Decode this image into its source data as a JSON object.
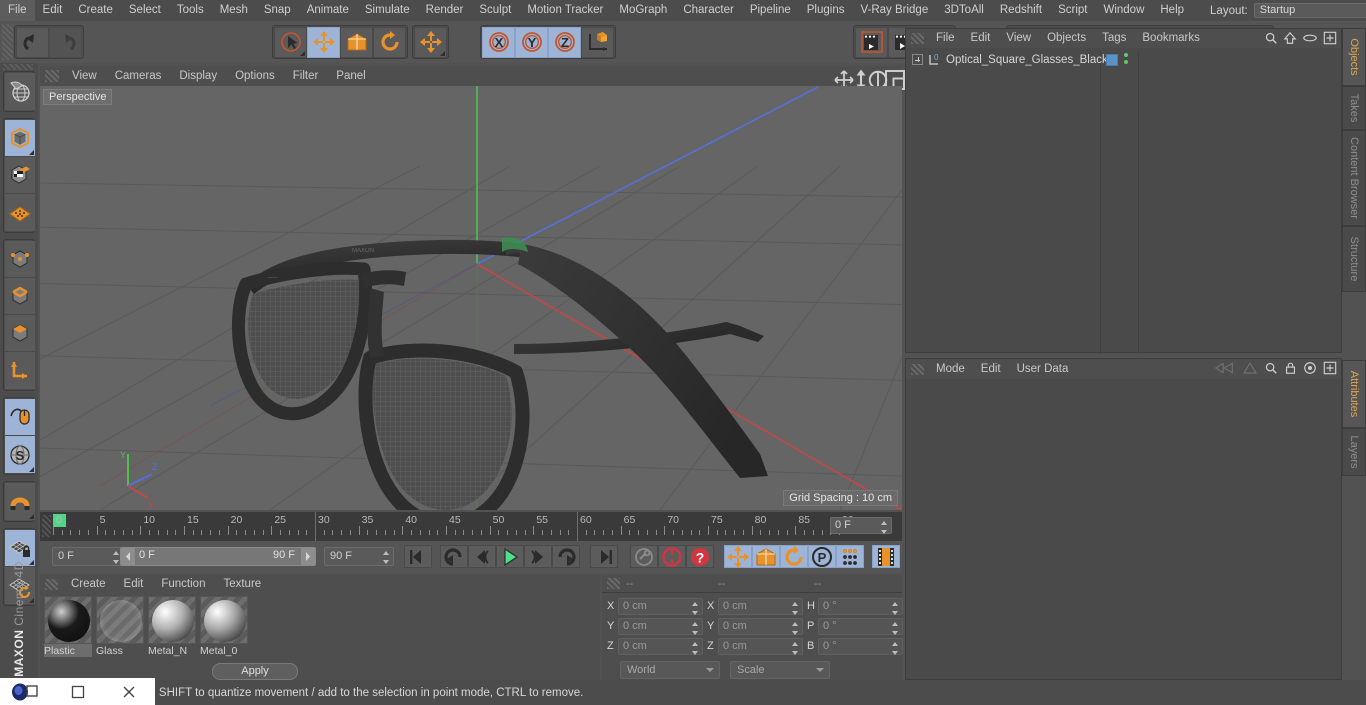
{
  "app": {
    "name": "Cinema 4D",
    "brand": "MAXON"
  },
  "menubar": {
    "items": [
      "File",
      "Edit",
      "Create",
      "Select",
      "Tools",
      "Mesh",
      "Snap",
      "Animate",
      "Simulate",
      "Render",
      "Sculpt",
      "Motion Tracker",
      "MoGraph",
      "Character",
      "Pipeline",
      "Plugins",
      "V-Ray Bridge",
      "3DToAll",
      "Redshift",
      "Script",
      "Window",
      "Help"
    ],
    "layout_label": "Layout:",
    "layout_value": "Startup",
    "search_icon": "search-icon"
  },
  "toolbar": {
    "groups": [
      {
        "name": "undo-redo",
        "buttons": [
          {
            "name": "undo",
            "icon": "undo-arrow-icon",
            "active": false,
            "dim": false
          },
          {
            "name": "redo",
            "icon": "redo-arrow-icon",
            "active": false,
            "dim": true
          }
        ]
      },
      {
        "name": "transform-tools",
        "buttons": [
          {
            "name": "live-selection",
            "icon": "cursor-circle-icon",
            "active": false,
            "dim": false,
            "corner": true
          },
          {
            "name": "move",
            "icon": "move-arrows-icon",
            "active": true,
            "dim": false
          },
          {
            "name": "scale",
            "icon": "scale-box-icon",
            "active": false,
            "dim": false
          },
          {
            "name": "rotate",
            "icon": "rotate-arc-icon",
            "active": false,
            "dim": false
          }
        ]
      },
      {
        "name": "free-move",
        "buttons": [
          {
            "name": "free-move",
            "icon": "move-arrows-icon",
            "active": false,
            "dim": false,
            "corner": true
          }
        ]
      },
      {
        "name": "axis-locks",
        "buttons": [
          {
            "name": "lock-x",
            "icon": "axis-x-icon",
            "active": true,
            "dim": false
          },
          {
            "name": "lock-y",
            "icon": "axis-y-icon",
            "active": true,
            "dim": false
          },
          {
            "name": "lock-z",
            "icon": "axis-z-icon",
            "active": true,
            "dim": false
          },
          {
            "name": "world-object-coord",
            "icon": "world-axis-cube-icon",
            "active": false,
            "dim": false
          }
        ]
      },
      {
        "name": "render-tools",
        "buttons": [
          {
            "name": "render-view",
            "icon": "clapper-view-icon",
            "active": false,
            "dim": false
          },
          {
            "name": "render-region",
            "icon": "clapper-region-icon",
            "active": false,
            "dim": false,
            "corner": true
          },
          {
            "name": "render-settings",
            "icon": "clapper-gear-icon",
            "active": false,
            "dim": false,
            "corner": true
          }
        ]
      },
      {
        "name": "create-objects",
        "buttons": [
          {
            "name": "add-cube",
            "icon": "blue-cube-icon",
            "active": false,
            "dim": false,
            "corner": true
          },
          {
            "name": "add-spline",
            "icon": "pen-spline-icon",
            "active": false,
            "dim": false,
            "corner": true
          },
          {
            "name": "add-generator",
            "icon": "green-cube-nurbs-icon",
            "active": false,
            "dim": false,
            "corner": true
          },
          {
            "name": "add-array",
            "icon": "green-cluster-icon",
            "active": false,
            "dim": false,
            "corner": true
          },
          {
            "name": "add-deformer",
            "icon": "purple-bend-icon",
            "active": false,
            "dim": false,
            "corner": true
          },
          {
            "name": "add-scene-floor",
            "icon": "grid-floor-icon",
            "active": false,
            "dim": false,
            "corner": true
          },
          {
            "name": "add-camera",
            "icon": "camera-icon",
            "active": false,
            "dim": false,
            "corner": true
          },
          {
            "name": "add-light",
            "icon": "lightbulb-icon",
            "active": false,
            "dim": false,
            "corner": true
          }
        ]
      }
    ]
  },
  "left_toolbar": {
    "buttons": [
      {
        "name": "make-editable",
        "icon": "globe-wire-icon",
        "active": false
      },
      {
        "name": "model-mode",
        "icon": "grey-cube-orange-outline-icon",
        "active": true,
        "corner": true
      },
      {
        "name": "texture-mode",
        "icon": "checker-cube-icon",
        "active": false
      },
      {
        "name": "point-mode-grid",
        "icon": "orange-grid-diamond-icon",
        "active": false
      },
      {
        "name": "points-mode",
        "icon": "cube-points-icon",
        "active": false
      },
      {
        "name": "edges-mode",
        "icon": "cube-edges-icon",
        "active": false
      },
      {
        "name": "polygons-mode",
        "icon": "cube-polygons-icon",
        "active": false
      },
      {
        "name": "axis-mode",
        "icon": "orange-axis-L-icon",
        "active": false
      },
      {
        "name": "enable-snapping",
        "icon": "mouse-snap-icon",
        "active": true
      },
      {
        "name": "workplane-mode",
        "icon": "s-sphere-icon",
        "active": true,
        "corner": true
      },
      {
        "name": "magnet-tool",
        "icon": "magnet-icon",
        "active": false,
        "corner": true
      },
      {
        "name": "lock-workplane",
        "icon": "grid-lock-icon",
        "active": true,
        "corner": true
      },
      {
        "name": "rotate-workplane",
        "icon": "grid-rotate-icon",
        "active": false,
        "corner": true
      }
    ]
  },
  "viewport": {
    "menu": [
      "View",
      "Cameras",
      "Display",
      "Options",
      "Filter",
      "Panel"
    ],
    "label": "Perspective",
    "grid_spacing": "Grid Spacing : 10 cm",
    "axis_gizmo": {
      "x": "X",
      "y": "Y",
      "z": "Z",
      "x_color": "#d04a4a",
      "y_color": "#4fbf4f",
      "z_color": "#5570d8"
    },
    "right_icons": [
      "pan-icon",
      "dolly-icon",
      "rotate-view-icon",
      "maximize-view-icon"
    ],
    "model_name": "optical-square-glasses-black"
  },
  "timeline": {
    "ticks": [
      0,
      5,
      10,
      15,
      20,
      25,
      30,
      35,
      40,
      45,
      50,
      55,
      60,
      65,
      70,
      75,
      80,
      85,
      90
    ],
    "current_frame_field": "0 F",
    "playhead_frame": 0
  },
  "playback": {
    "current_frame": "0 F",
    "range_start": "0 F",
    "range_end": "90 F",
    "max_frame": "90 F",
    "buttons": [
      {
        "name": "go-to-start",
        "icon": "skip-start-icon",
        "active": false
      },
      {
        "name": "previous-keyframe",
        "icon": "prev-key-icon",
        "active": false
      },
      {
        "name": "step-back",
        "icon": "step-back-icon",
        "active": false
      },
      {
        "name": "play",
        "icon": "play-icon",
        "active": false
      },
      {
        "name": "step-forward",
        "icon": "step-forward-icon",
        "active": false
      },
      {
        "name": "next-keyframe",
        "icon": "next-key-icon",
        "active": false
      },
      {
        "name": "go-to-end",
        "icon": "skip-end-icon",
        "active": false
      },
      {
        "name": "record-active-objects",
        "icon": "key-grey-icon",
        "active": false
      },
      {
        "name": "autokeying",
        "icon": "record-red-icon",
        "active": false
      },
      {
        "name": "keyframe-help",
        "icon": "question-red-icon",
        "active": false
      },
      {
        "name": "key-position",
        "icon": "move-arrows-icon",
        "active": true
      },
      {
        "name": "key-scale",
        "icon": "scale-box-icon",
        "active": true
      },
      {
        "name": "key-rotation",
        "icon": "rotate-arc-icon",
        "active": true
      },
      {
        "name": "key-parameter",
        "icon": "p-circle-icon",
        "active": true
      },
      {
        "name": "key-point-level",
        "icon": "dots-grid-icon",
        "active": true
      },
      {
        "name": "timeline-toggle",
        "icon": "film-strip-icon",
        "active": true
      }
    ]
  },
  "material_manager": {
    "menu": [
      "Create",
      "Edit",
      "Function",
      "Texture"
    ],
    "materials": [
      {
        "name": "Plastic",
        "color": "#1a1a1a",
        "highlight": "#cfcfcf",
        "selected": true,
        "type": "solid"
      },
      {
        "name": "Glass",
        "color": "transparent",
        "highlight": "none",
        "selected": false,
        "type": "transparent"
      },
      {
        "name": "Metal_N",
        "color": "#b0b0b0",
        "highlight": "#ffffff",
        "selected": false,
        "type": "solid"
      },
      {
        "name": "Metal_0",
        "color": "#a8a8a8",
        "highlight": "#ffffff",
        "selected": false,
        "type": "solid"
      }
    ]
  },
  "coordinates": {
    "header_cols": [
      "--",
      "--",
      "--"
    ],
    "position": {
      "label_x": "X",
      "label_y": "Y",
      "label_z": "Z",
      "x": "0 cm",
      "y": "0 cm",
      "z": "0 cm"
    },
    "size": {
      "label_x": "X",
      "label_y": "Y",
      "label_z": "Z",
      "x": "0 cm",
      "y": "0 cm",
      "z": "0 cm"
    },
    "rotation": {
      "label_h": "H",
      "label_p": "P",
      "label_b": "B",
      "h": "0 °",
      "p": "0 °",
      "b": "0 °"
    },
    "space_dropdown": "World",
    "mode_dropdown": "Scale",
    "apply_button": "Apply"
  },
  "object_manager": {
    "menu": [
      "File",
      "Edit",
      "View",
      "Objects",
      "Tags",
      "Bookmarks"
    ],
    "right_icons": [
      "search-icon",
      "home-icon",
      "ellipse-icon",
      "plus-box-icon"
    ],
    "objects": [
      {
        "name": "Optical_Square_Glasses_Black",
        "layer": "0",
        "tag_color": "#5b93c9",
        "visible_dots": 2
      }
    ]
  },
  "attribute_manager": {
    "menu": [
      "Mode",
      "Edit",
      "User Data"
    ],
    "right_icons": [
      "nav-back-icon",
      "nav-up-icon",
      "search-icon",
      "lock-icon",
      "target-icon",
      "plus-box-icon"
    ]
  },
  "right_tabs": {
    "top": [
      {
        "label": "Objects",
        "active": true
      },
      {
        "label": "Takes",
        "active": false
      },
      {
        "label": "Content Browser",
        "active": false
      },
      {
        "label": "Structure",
        "active": false
      }
    ],
    "bottom": [
      {
        "label": "Attributes",
        "active": true
      },
      {
        "label": "Layers",
        "active": false
      }
    ]
  },
  "status_bar": {
    "message": "Move elements. Hold down SHIFT to quantize movement / add to the selection in point mode, CTRL to remove.",
    "visible_message": "move elements. Hold down SHIFT to quantize movement / add to the selection in point mode, CTRL to remove."
  },
  "taskbar_overlay": {
    "icons": [
      "app-blob-icon",
      "restore-window-icon",
      "maximize-window-icon",
      "close-window-icon"
    ]
  },
  "colors": {
    "accent_orange": "#e8922c",
    "active_blue": "#9db4d6",
    "panel_bg": "#4e4e4e",
    "viewport_bg": "#656565",
    "text": "#c8c8c8"
  }
}
